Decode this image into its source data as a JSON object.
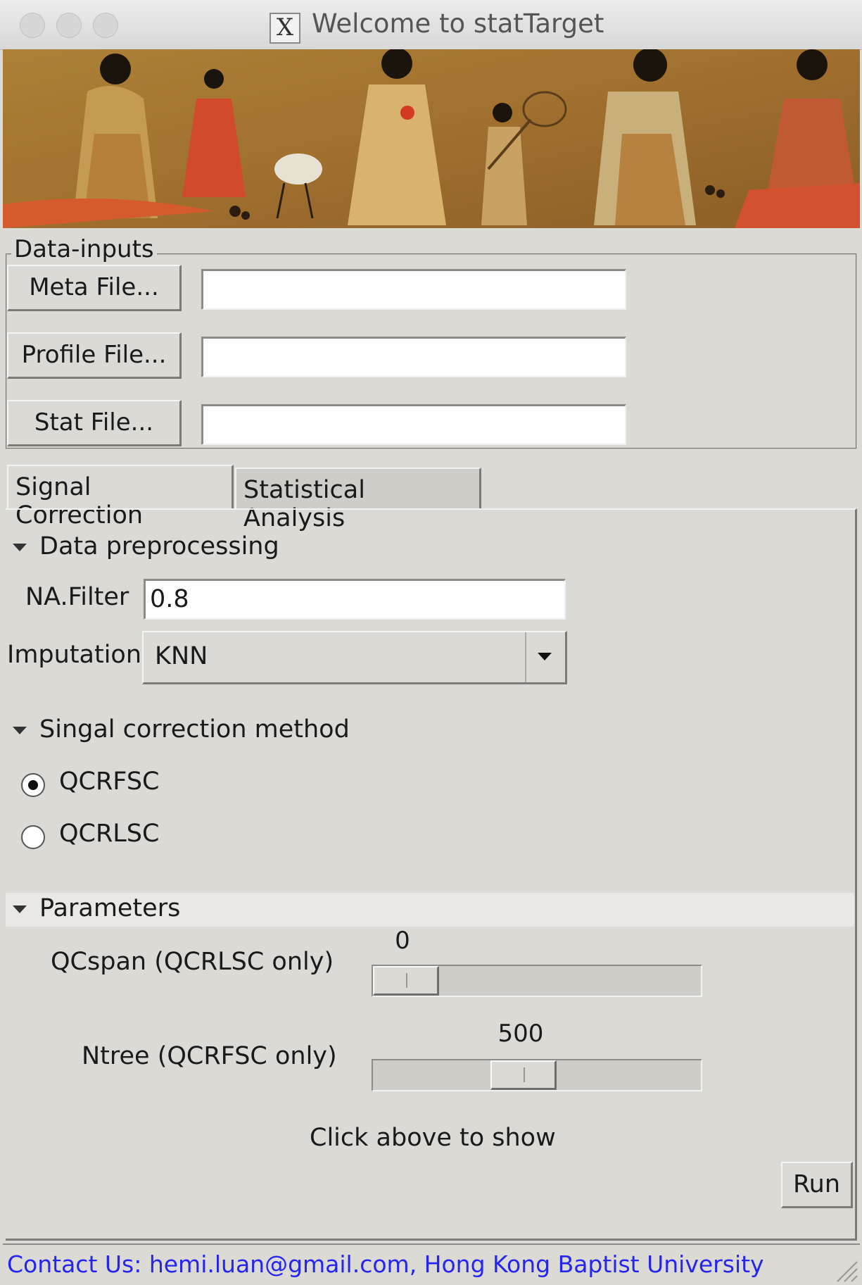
{
  "window": {
    "title": "Welcome to statTarget",
    "logo_glyph": "X"
  },
  "data_inputs": {
    "group_label": "Data-inputs",
    "meta_button": "Meta File...",
    "profile_button": "Profile File...",
    "stat_button": "Stat File...",
    "meta_value": "",
    "profile_value": "",
    "stat_value": ""
  },
  "tabs": [
    {
      "label": "Signal Correction",
      "active": true
    },
    {
      "label": "Statistical Analysis",
      "active": false
    }
  ],
  "preprocessing": {
    "header": "Data preprocessing",
    "na_filter_label": "NA.Filter",
    "na_filter_value": "0.8",
    "imputation_label": "Imputation",
    "imputation_value": "KNN"
  },
  "correction": {
    "header": "Singal correction method",
    "options": [
      "QCRFSC",
      "QCRLSC"
    ],
    "selected": "QCRFSC"
  },
  "parameters": {
    "header": "Parameters",
    "qcspan_label": "QCspan (QCRLSC only)",
    "qcspan_value": "0",
    "qcspan_fraction": 0,
    "ntree_label": "Ntree (QCRFSC only)",
    "ntree_value": "500",
    "ntree_fraction": 0.45,
    "hint": "Click above to show",
    "run_button": "Run"
  },
  "footer": {
    "contact": "Contact Us: hemi.luan@gmail.com, Hong Kong Baptist University"
  },
  "colors": {
    "background": "#dcdad5",
    "link": "#2525f0",
    "painting": "#a8762e"
  }
}
